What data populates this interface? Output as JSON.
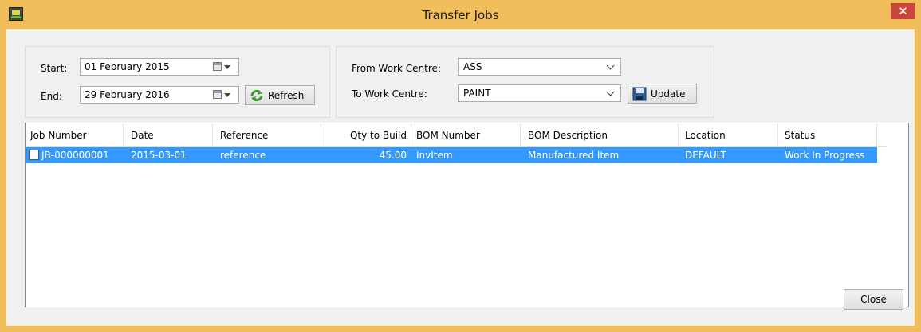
{
  "window": {
    "title": "Transfer Jobs",
    "close_glyph": "✕"
  },
  "dates": {
    "start_label": "Start:",
    "start_value": "01  February  2015",
    "end_label": "End:",
    "end_value": "29  February  2016",
    "refresh_label": "Refresh"
  },
  "workcentres": {
    "from_label": "From Work Centre:",
    "from_value": "ASS",
    "to_label": "To Work Centre:",
    "to_value": "PAINT",
    "update_label": "Update"
  },
  "table": {
    "columns": [
      "Job Number",
      "Date",
      "Reference",
      "Qty to Build",
      "BOM Number",
      "BOM Description",
      "Location",
      "Status"
    ],
    "rows": [
      {
        "checked": false,
        "cells": [
          "JB-000000001",
          "2015-03-01",
          "reference",
          "45.00",
          "InvItem",
          "Manufactured Item",
          "DEFAULT",
          "Work In Progress"
        ]
      }
    ]
  },
  "footer": {
    "close_label": "Close"
  },
  "colors": {
    "title_bar": "#f2be5c",
    "selection": "#3399ff",
    "close_button": "#c8453a"
  }
}
